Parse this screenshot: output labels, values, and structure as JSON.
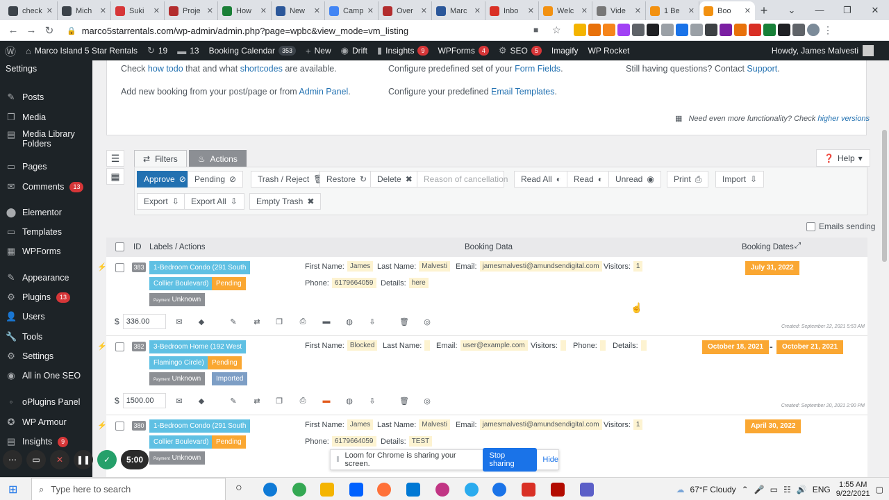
{
  "browser": {
    "tabs": [
      {
        "label": "check",
        "color": "#3c434a"
      },
      {
        "label": "Mich",
        "color": "#3c434a"
      },
      {
        "label": "Suki",
        "color": "#d63638"
      },
      {
        "label": "Proje",
        "color": "#b32d2e"
      },
      {
        "label": "How",
        "color": "#1a7f37"
      },
      {
        "label": "New",
        "color": "#2b579a"
      },
      {
        "label": "Camp",
        "color": "#4285f4"
      },
      {
        "label": "Over",
        "color": "#b32d2e"
      },
      {
        "label": "Marc",
        "color": "#2b579a"
      },
      {
        "label": "Inbo",
        "color": "#d93025"
      },
      {
        "label": "Welc",
        "color": "#f29111"
      },
      {
        "label": "Vide",
        "color": "#777777"
      },
      {
        "label": "1 Be",
        "color": "#f29111"
      },
      {
        "label": "Boo",
        "color": "#f29111",
        "active": true
      }
    ],
    "url": "marco5starrentals.com/wp-admin/admin.php?page=wpbc&view_mode=vm_listing"
  },
  "wp_admin_bar": {
    "site": "Marco Island 5 Star Rentals",
    "updates": "19",
    "comments": "13",
    "booking_calendar": "Booking Calendar",
    "booking_count": "353",
    "new": "New",
    "drift": "Drift",
    "insights": "Insights",
    "insights_count": "9",
    "wpforms": "WPForms",
    "wpforms_count": "4",
    "seo": "SEO",
    "seo_count": "5",
    "imagify": "Imagify",
    "wp_rocket": "WP Rocket",
    "howdy": "Howdy, James Malvesti"
  },
  "sidebar": {
    "settings_top": "Settings",
    "items": [
      {
        "label": "Posts",
        "icon": "✎"
      },
      {
        "label": "Media",
        "icon": "❐"
      },
      {
        "label": "Media Library Folders",
        "icon": "▤"
      },
      {
        "label": "Pages",
        "icon": "▭"
      },
      {
        "label": "Comments",
        "icon": "✉",
        "badge": "13"
      },
      {
        "label": "Elementor",
        "icon": "⬤"
      },
      {
        "label": "Templates",
        "icon": "▭"
      },
      {
        "label": "WPForms",
        "icon": "▦"
      },
      {
        "label": "Appearance",
        "icon": "✎"
      },
      {
        "label": "Plugins",
        "icon": "⚙",
        "badge": "13"
      },
      {
        "label": "Users",
        "icon": "👤"
      },
      {
        "label": "Tools",
        "icon": "🔧"
      },
      {
        "label": "Settings",
        "icon": "⚙"
      },
      {
        "label": "All in One SEO",
        "icon": "◉"
      },
      {
        "label": "oPlugins Panel",
        "icon": "◦"
      },
      {
        "label": "WP Armour",
        "icon": "✪"
      },
      {
        "label": "Insights",
        "icon": "▤",
        "badge": "9"
      }
    ]
  },
  "info": {
    "check": "Check",
    "how_todo": "how todo",
    "and_what": "that and what",
    "shortcodes": "shortcodes",
    "are_available": "are available.",
    "add_new": "Add new booking from your post/page or from",
    "admin_panel": "Admin Panel",
    "dot": ".",
    "configure_fields": "Configure predefined set of your",
    "form_fields": "Form Fields",
    "configure_templates": "Configure your predefined",
    "email_templates": "Email Templates",
    "still": "Still having questions? Contact",
    "support": "Support",
    "need_more": "Need even more functionality? Check",
    "higher_versions": "higher versions"
  },
  "toolbar": {
    "filters": "Filters",
    "actions": "Actions",
    "help": "Help",
    "approve": "Approve",
    "pending": "Pending",
    "trash_reject": "Trash / Reject",
    "restore": "Restore",
    "delete": "Delete",
    "reason_placeholder": "Reason of cancellation",
    "read_all": "Read All",
    "read": "Read",
    "unread": "Unread",
    "print": "Print",
    "import": "Import",
    "export": "Export",
    "export_all": "Export All",
    "empty_trash": "Empty Trash",
    "emails_sending": "Emails sending"
  },
  "table": {
    "col_id": "ID",
    "col_labels": "Labels / Actions",
    "col_data": "Booking Data",
    "col_dates": "Booking Dates"
  },
  "labels": {
    "first_name": "First Name:",
    "last_name": "Last Name:",
    "email": "Email:",
    "visitors": "Visitors:",
    "phone": "Phone:",
    "details": "Details:",
    "pending": "Pending",
    "payment": "Payment",
    "unknown": "Unknown",
    "imported": "Imported",
    "currency": "$"
  },
  "bookings": [
    {
      "id": "383",
      "resource_line1": "1-Bedroom Condo (291 South",
      "resource_line2": "Collier Boulevard)",
      "first_name": "James",
      "last_name": "Malvesti",
      "email": "jamesmalvesti@amundsendigital.com",
      "visitors": "1",
      "phone": "6179664059",
      "details": "here",
      "date1": "July 31, 2022",
      "cost": "336.00",
      "created": "Created: September 22, 2021 5:53 AM"
    },
    {
      "id": "382",
      "resource_line1": "3-Bedroom Home (192 West",
      "resource_line2": "Flamingo Circle)",
      "first_name": "Blocked",
      "last_name": "",
      "email": "user@example.com",
      "visitors": "",
      "phone": "",
      "details": "",
      "date1": "October 18, 2021",
      "dash": "-",
      "date2": "October 21, 2021",
      "cost": "1500.00",
      "created": "Created: September 20, 2021 2:00 PM"
    },
    {
      "id": "380",
      "resource_line1": "1-Bedroom Condo (291 South",
      "resource_line2": "Collier Boulevard)",
      "first_name": "James",
      "last_name": "Malvesti",
      "email": "jamesmalvesti@amundsendigital.com",
      "visitors": "1",
      "phone": "6179664059",
      "details": "TEST",
      "date1": "April 30, 2022"
    }
  ],
  "loom": {
    "message": "Loom for Chrome is sharing your screen.",
    "stop": "Stop sharing",
    "hide": "Hide",
    "timer": "5:00"
  },
  "taskbar": {
    "search_placeholder": "Type here to search",
    "weather": "67°F Cloudy",
    "lang": "ENG",
    "time": "1:55 AM",
    "date": "9/22/2021"
  }
}
